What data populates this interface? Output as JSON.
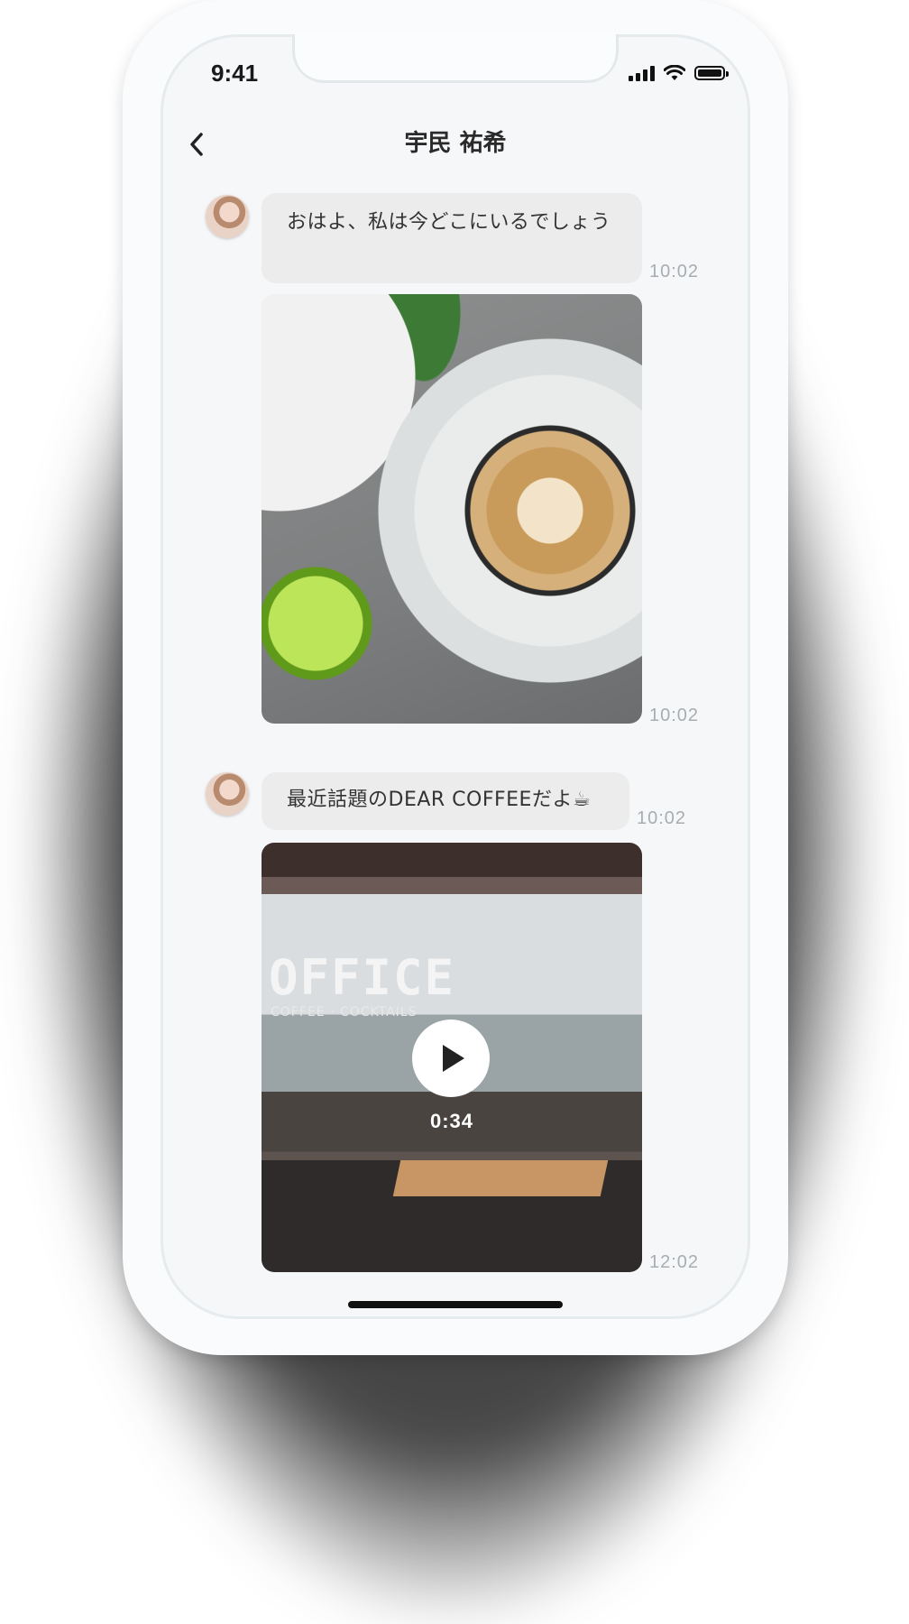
{
  "status_bar": {
    "time": "9:41",
    "icons": [
      "signal-icon",
      "wifi-icon",
      "battery-icon"
    ]
  },
  "header": {
    "title": "宇民 祐希",
    "back_icon": "chevron-left-icon"
  },
  "messages": [
    {
      "type": "text",
      "text": "おはよ、私は今どこにいるでしょう",
      "time": "10:02"
    },
    {
      "type": "image",
      "description_icon": "photo-latte",
      "time": "10:02"
    },
    {
      "type": "text",
      "text": "最近話題のDEAR COFFEEだよ☕",
      "time": "10:02"
    },
    {
      "type": "video",
      "duration": "0:34",
      "sign_text": "OFFICE",
      "sign_subtext": "COFFEE · COCKTAILS",
      "time": "12:02"
    }
  ],
  "colors": {
    "bubble": "#ececec",
    "timestamp": "#a7adb1",
    "screen_bg": "#f6f7f9"
  }
}
